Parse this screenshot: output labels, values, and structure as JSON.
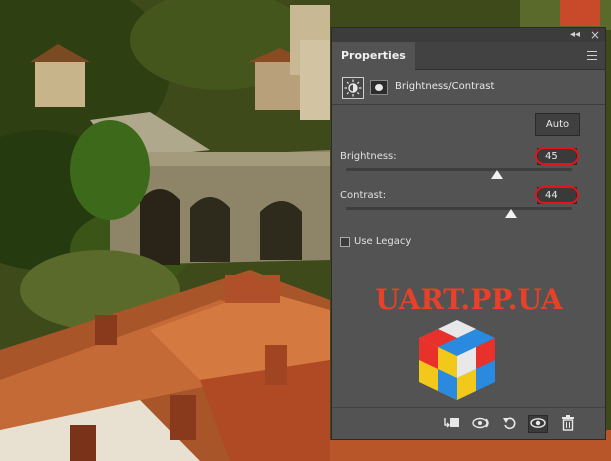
{
  "panel": {
    "tab_label": "Properties",
    "collapse_glyph": "◂◂",
    "close_glyph": "×",
    "adjustment_title": "Brightness/Contrast",
    "auto_label": "Auto",
    "brightness": {
      "label": "Brightness:",
      "value": "45",
      "slider_fraction": 0.67
    },
    "contrast": {
      "label": "Contrast:",
      "value": "44",
      "slider_fraction": 0.73
    },
    "use_legacy_label": "Use Legacy",
    "use_legacy_checked": false,
    "watermark": "UART.PP.UA",
    "bottom_icons": [
      "clip-to-layer-icon",
      "view-previous-state-icon",
      "reset-icon",
      "visibility-icon",
      "delete-icon"
    ],
    "colors": {
      "panel_bg": "#535353",
      "highlight_circle": "#e8131a",
      "watermark": "#e8412a"
    }
  }
}
